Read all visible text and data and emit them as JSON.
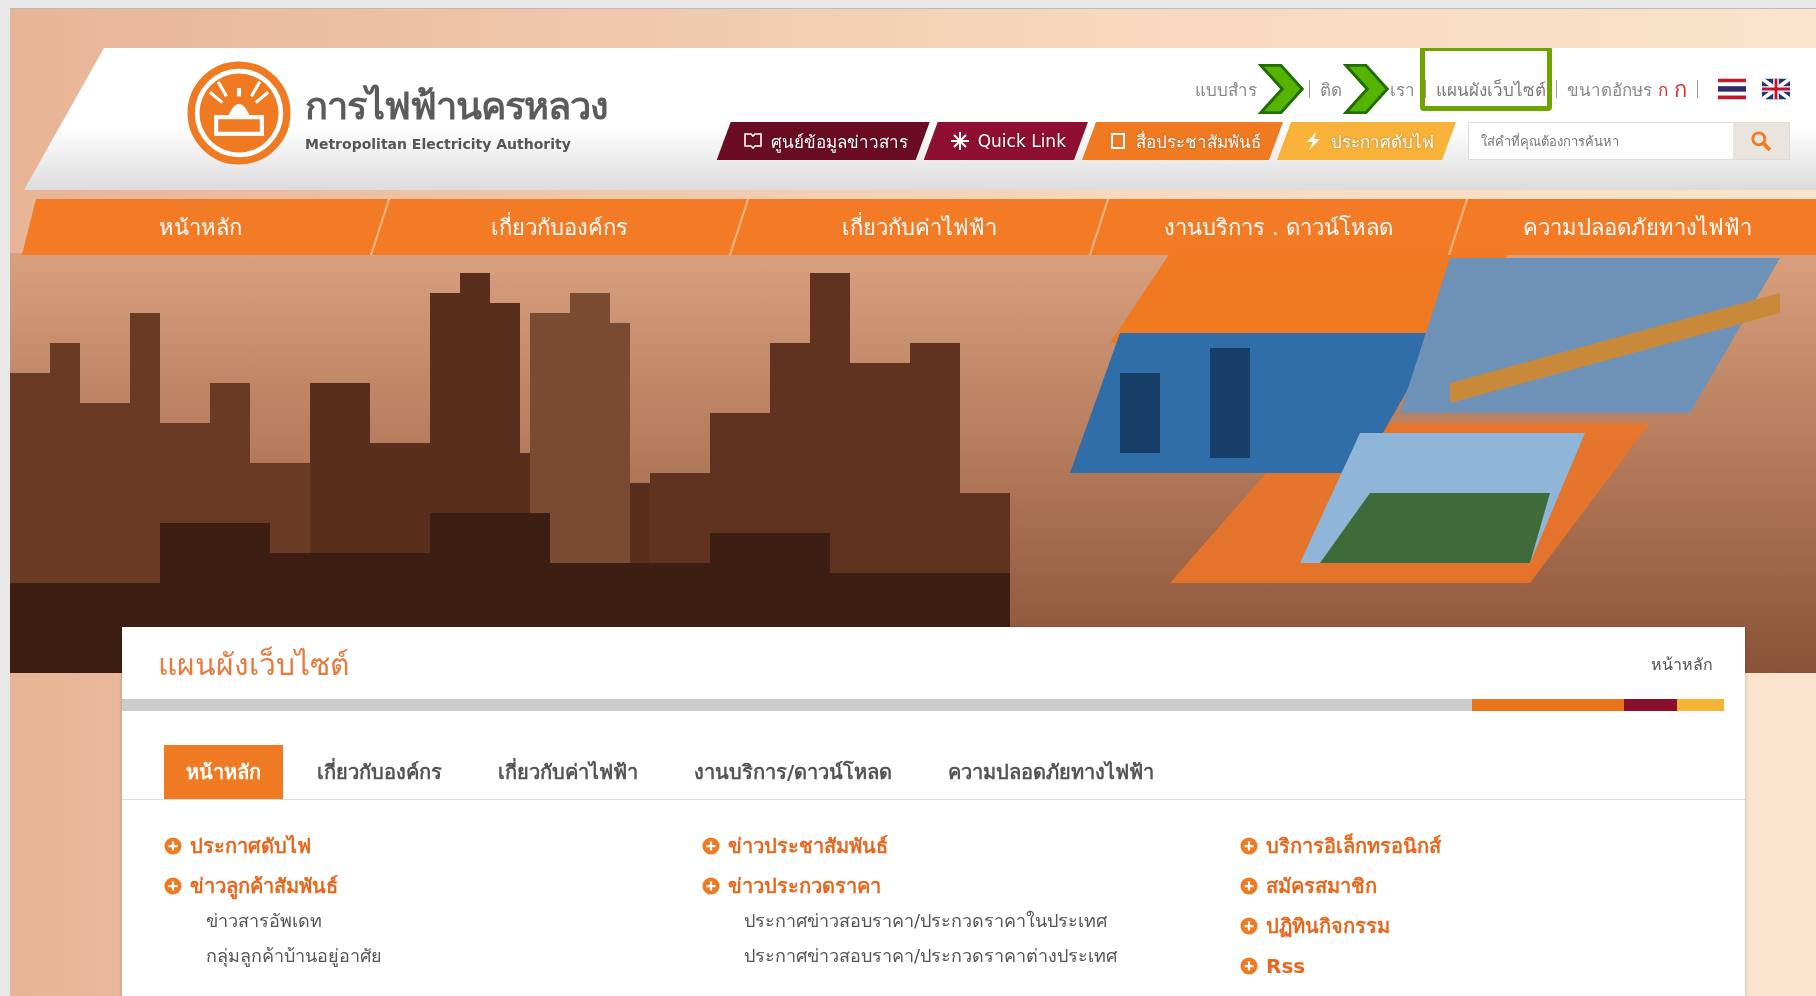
{
  "header": {
    "logo_title": "การไฟฟ้านครหลวง",
    "logo_subtitle": "Metropolitan Electricity Authority",
    "top_links": [
      {
        "text": "แบบสำร",
        "arrow_after": true
      },
      {
        "text": "ติด",
        "arrow_after": true,
        "tail": "เรา"
      },
      {
        "text": "แผนผังเว็บไซต์",
        "highlighted": true
      },
      {
        "text": "ขนาดอักษร",
        "font_sizes": [
          "ก",
          "ก"
        ]
      }
    ],
    "languages": [
      {
        "kind": "thai-flag"
      },
      {
        "kind": "uk-flag"
      }
    ],
    "quick_bar": [
      {
        "label": "ศูนย์ข้อมูลข่าวสาร",
        "color": "#6a0d24"
      },
      {
        "label": "Quick Link",
        "color": "#8e0f31"
      },
      {
        "label": "สื่อประชาสัมพันธ์",
        "color": "#f07a22"
      },
      {
        "label": "ประกาศดับไฟ",
        "color": "#f8b23a"
      }
    ],
    "search": {
      "placeholder": "ใส่คำที่คุณต้องการค้นหา"
    }
  },
  "main_nav": [
    {
      "label": "หน้าหลัก"
    },
    {
      "label": "เกี่ยวกับองค์กร"
    },
    {
      "label": "เกี่ยวกับค่าไฟฟ้า"
    },
    {
      "label": "งานบริการ . ดาวน์โหลด"
    },
    {
      "label": "ความปลอดภัยทางไฟฟ้า"
    }
  ],
  "content": {
    "title": "แผนผังเว็บไซต์",
    "breadcrumb": "หน้าหลัก",
    "tabs": [
      {
        "label": "หน้าหลัก",
        "selected": true
      },
      {
        "label": "เกี่ยวกับองค์กร",
        "selected": false
      },
      {
        "label": "เกี่ยวกับค่าไฟฟ้า",
        "selected": false
      },
      {
        "label": "งานบริการ/ดาวน์โหลด",
        "selected": false
      },
      {
        "label": "ความปลอดภัยทางไฟฟ้า",
        "selected": false
      }
    ],
    "columns": [
      [
        {
          "label": "ประกาศดับไฟ"
        },
        {
          "label": "ข่าวลูกค้าสัมพันธ์",
          "children": [
            {
              "label": "ข่าวสารอัพเดท"
            },
            {
              "label": "กลุ่มลูกค้าบ้านอยู่อาศัย"
            }
          ]
        }
      ],
      [
        {
          "label": "ข่าวประชาสัมพันธ์"
        },
        {
          "label": "ข่าวประกวดราคา",
          "children": [
            {
              "label": "ประกาศข่าวสอบราคา/ประกวดราคาในประเทศ"
            },
            {
              "label": "ประกาศข่าวสอบราคา/ประกวดราคาต่างประเทศ"
            }
          ]
        }
      ],
      [
        {
          "label": "บริการอิเล็กทรอนิกส์"
        },
        {
          "label": "สมัครสมาชิก"
        },
        {
          "label": "ปฏิทินกิจกรรม"
        },
        {
          "label": "Rss"
        }
      ]
    ]
  }
}
